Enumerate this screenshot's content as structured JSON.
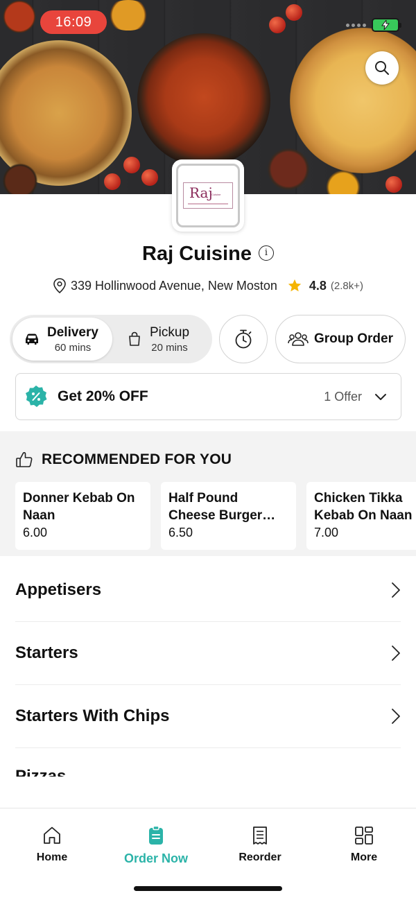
{
  "status_bar": {
    "time": "16:09"
  },
  "restaurant": {
    "name": "Raj Cuisine",
    "logo_text": "Raj",
    "logo_subtext": "Cuisine",
    "address": "339 Hollinwood Avenue, New Moston",
    "rating": "4.8",
    "rating_count": "(2.8k+)"
  },
  "order_type": {
    "delivery_label": "Delivery",
    "delivery_time": "60 mins",
    "pickup_label": "Pickup",
    "pickup_time": "20 mins",
    "group_order_label": "Group Order"
  },
  "offer": {
    "title": "Get 20% OFF",
    "count": "1 Offer"
  },
  "recommended": {
    "title": "RECOMMENDED FOR YOU",
    "items": [
      {
        "name": "Donner Kebab On Naan",
        "price": "6.00"
      },
      {
        "name": "Half Pound Cheese Burger Meal",
        "price": "6.50"
      },
      {
        "name": "Chicken Tikka Kebab On Naan",
        "price": "7.00"
      }
    ]
  },
  "categories": [
    "Appetisers",
    "Starters",
    "Starters With Chips",
    "Pizzas"
  ],
  "bottom_nav": {
    "items": [
      {
        "label": "Home",
        "icon": "home-icon"
      },
      {
        "label": "Order Now",
        "icon": "order-icon",
        "active": true
      },
      {
        "label": "Reorder",
        "icon": "receipt-icon"
      },
      {
        "label": "More",
        "icon": "grid-icon"
      }
    ]
  },
  "colors": {
    "accent": "#2bb3a8",
    "status_time_bg": "#e8453c",
    "star": "#f5b400",
    "battery": "#38c95a"
  }
}
